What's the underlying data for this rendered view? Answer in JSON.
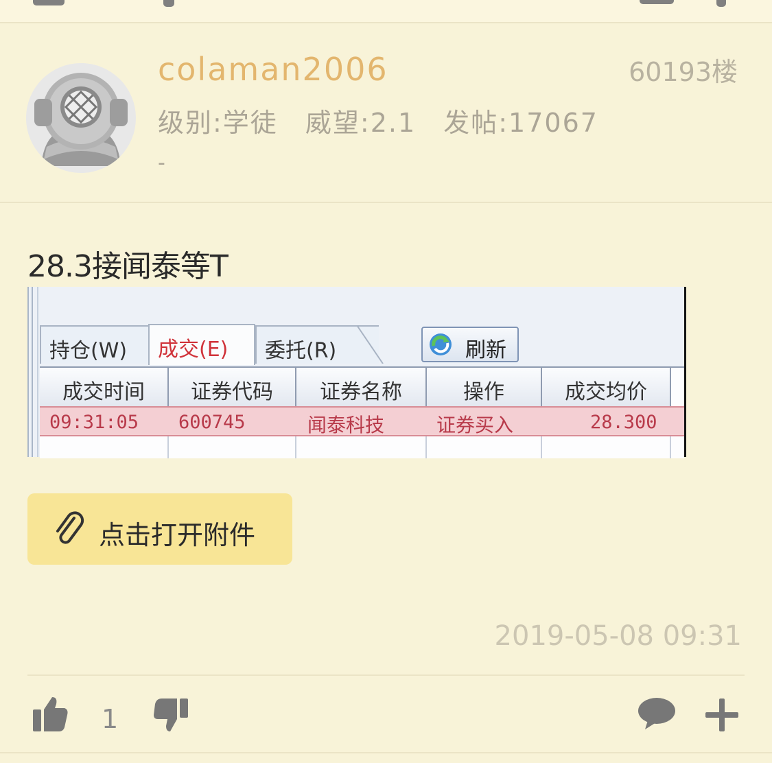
{
  "post": {
    "username": "colaman2006",
    "floor": "60193楼",
    "level": "级别:学徒",
    "prestige": "威望:2.1",
    "posts": "发帖:17067",
    "signature": "-",
    "content": "28.3接闻泰等T",
    "timestamp": "2019-05-08 09:31",
    "likes": "1"
  },
  "attachment": {
    "label": "点击打开附件"
  },
  "screenshot": {
    "tabs": [
      "持仓(W)",
      "成交(E)",
      "委托(R)"
    ],
    "active_tab": 1,
    "refresh_label": "刷新",
    "columns": [
      "成交时间",
      "证券代码",
      "证券名称",
      "操作",
      "成交均价"
    ],
    "row": [
      "09:31:05",
      "600745",
      "闻泰科技",
      "证券买入",
      "28.300"
    ]
  },
  "colors": {
    "background": "#f8f3d8",
    "username": "#e3b66e",
    "attachment_bg": "#f8e596",
    "row_highlight": "#f4cfd3"
  },
  "icons": {
    "like": "thumbs-up-icon",
    "dislike": "thumbs-down-icon",
    "comment": "comment-bubble-icon",
    "more": "plus-icon",
    "attachment": "paperclip-icon"
  }
}
